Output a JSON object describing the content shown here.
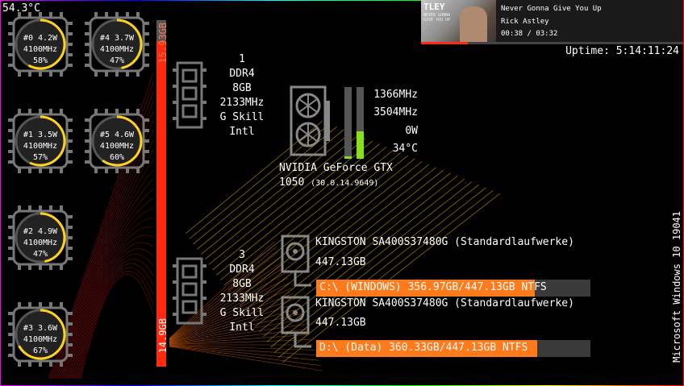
{
  "cpu_temp": "54.3°C",
  "uptime": "Uptime: 5:14:11:24",
  "os": "Microsoft Windows 10 19041",
  "cores": [
    {
      "id": "#0",
      "watt": "4.2W",
      "freq": "4100MHz",
      "load": "58%",
      "fill": 0.58
    },
    {
      "id": "#4",
      "watt": "3.7W",
      "freq": "4100MHz",
      "load": "47%",
      "fill": 0.47
    },
    {
      "id": "#1",
      "watt": "3.5W",
      "freq": "4100MHz",
      "load": "57%",
      "fill": 0.57
    },
    {
      "id": "#5",
      "watt": "4.6W",
      "freq": "4100MHz",
      "load": "60%",
      "fill": 0.6
    },
    {
      "id": "#2",
      "watt": "4.9W",
      "freq": "4100MHz",
      "load": "47%",
      "fill": 0.47
    },
    {
      "id": "#3",
      "watt": "3.6W",
      "freq": "4100MHz",
      "load": "67%",
      "fill": 0.67
    }
  ],
  "ram": {
    "total": "15.93GB",
    "used": "14.9GB",
    "used_fraction": 0.94,
    "modules": [
      {
        "slot": "1",
        "type": "DDR4",
        "size": "8GB",
        "speed": "2133MHz",
        "brand": "G Skill",
        "vendor": "Intl"
      },
      {
        "slot": "3",
        "type": "DDR4",
        "size": "8GB",
        "speed": "2133MHz",
        "brand": "G Skill",
        "vendor": "Intl"
      }
    ]
  },
  "gpu": {
    "core_clock": "1366MHz",
    "mem_clock": "3504MHz",
    "power": "0W",
    "temp": "34°C",
    "name": "NVIDIA GeForce GTX",
    "model": "1050",
    "driver": "(30.0.14.9649)",
    "bar1_fraction": 0.03,
    "bar2_fraction": 0.38
  },
  "disks": [
    {
      "model": "KINGSTON SA400S37480G (Standardlaufwerke)",
      "size": "447.13GB",
      "label": "C:\\ (WINDOWS) 356.97GB/447.13GB NTFS",
      "fraction": 0.798
    },
    {
      "model": "KINGSTON SA400S37480G (Standardlaufwerke)",
      "size": "447.13GB",
      "label": "D:\\ (Data) 360.33GB/447.13GB NTFS",
      "fraction": 0.806
    }
  ],
  "media": {
    "album_text": "TLEY",
    "album_sub": "NEVER GONNA GIVE YOU UP",
    "title": "Never Gonna Give You Up",
    "artist": "Rick Astley",
    "time": "00:38 / 03:32"
  },
  "colors": {
    "accent_yellow": "#ffd21a",
    "accent_orange": "#ff7a1a",
    "ram_red": "#ff2a10",
    "gpu_green": "#88e01a"
  }
}
